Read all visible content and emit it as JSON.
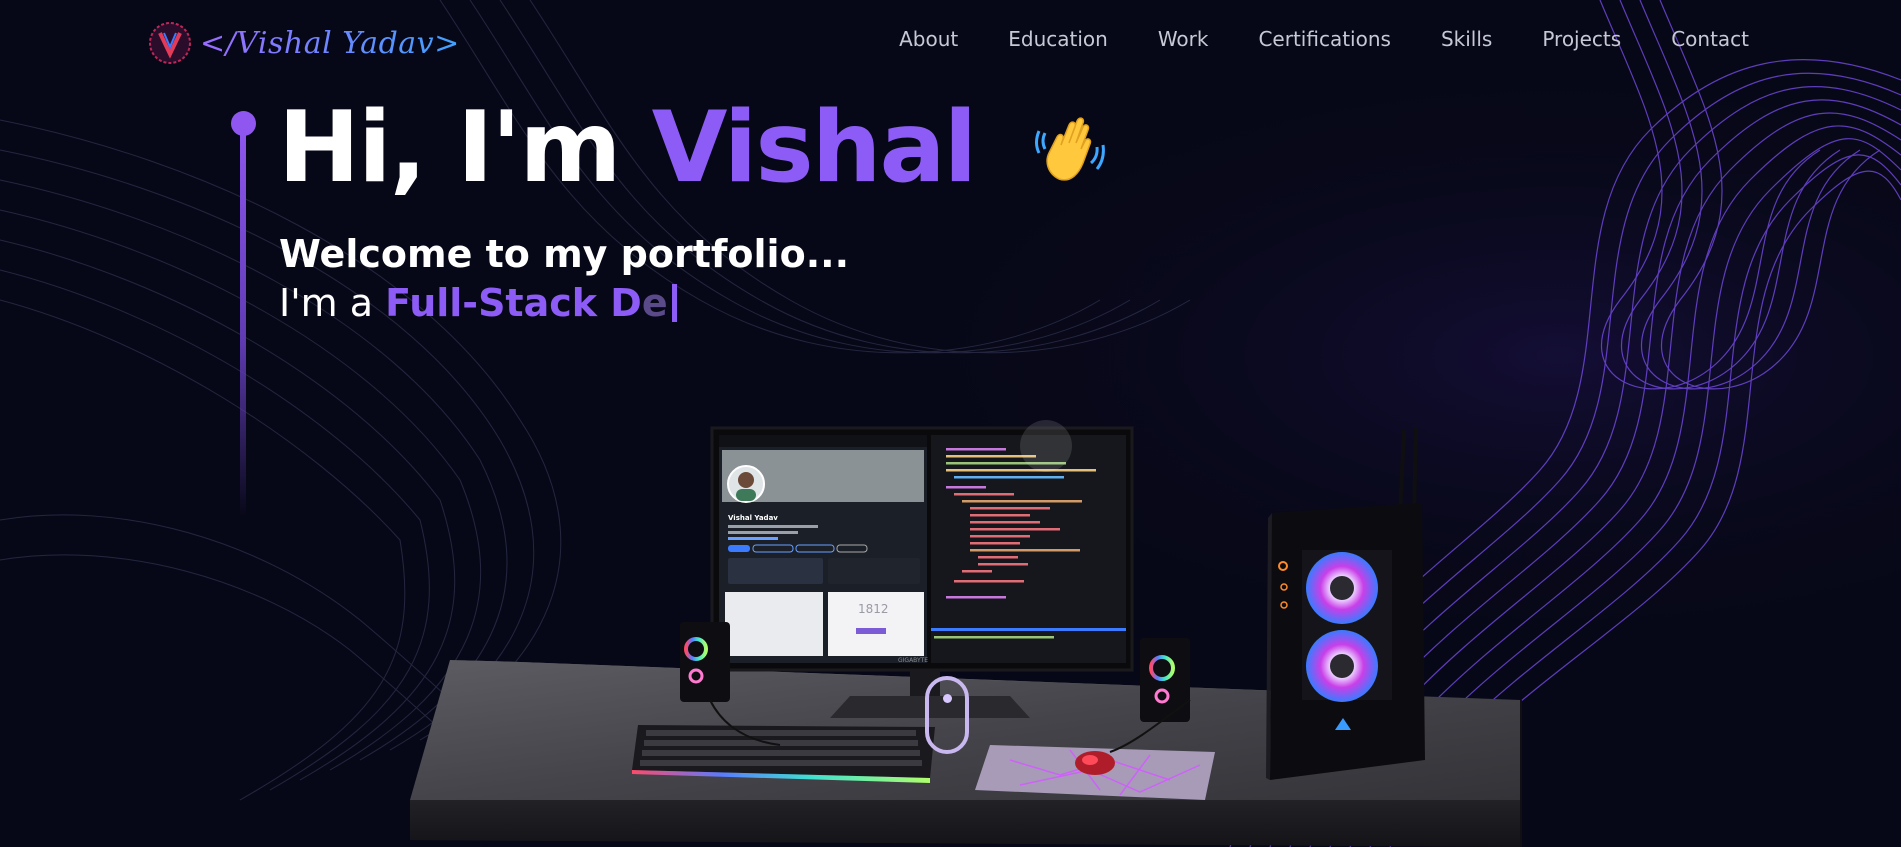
{
  "header": {
    "logo_text": "</Vishal Yadav>",
    "logo_icon": "v-logo-icon",
    "nav": [
      {
        "label": "About"
      },
      {
        "label": "Education"
      },
      {
        "label": "Work"
      },
      {
        "label": "Certifications"
      },
      {
        "label": "Skills"
      },
      {
        "label": "Projects"
      },
      {
        "label": "Contact"
      }
    ]
  },
  "hero": {
    "greeting": "Hi, I'm ",
    "name": "Vishal",
    "wave_icon": "waving-hand-icon",
    "subtitle": "Welcome to my portfolio...",
    "typing_prefix": "I'm a ",
    "typing_role": "Full-Stack D",
    "typing_ghost": "e"
  },
  "scene": {
    "monitor_profile_name": "Vishal Yadav",
    "monitor_stat": "1812",
    "monitor_brand": "GIGABYTE",
    "scroll_indicator": "mouse-scroll-icon"
  },
  "colors": {
    "background": "#070817",
    "accent": "#8d5cf6",
    "nav_text": "#c7c8d6"
  }
}
